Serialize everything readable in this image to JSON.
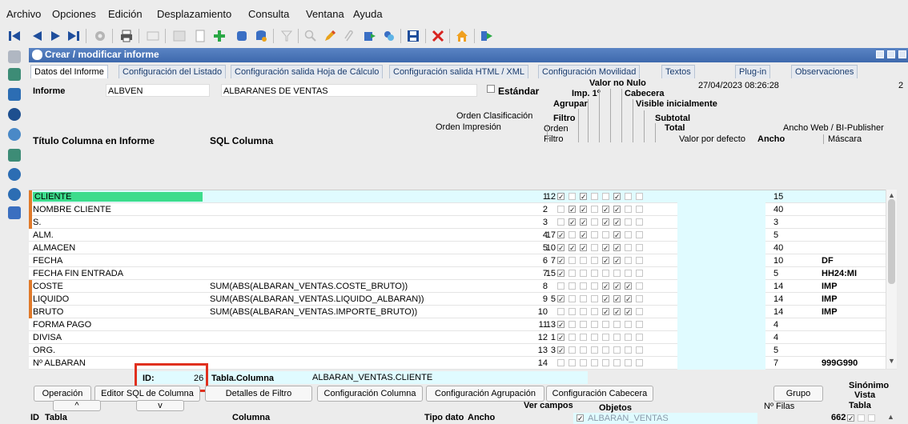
{
  "menu": [
    "Archivo",
    "Opciones",
    "Edición",
    "Desplazamiento",
    "Consulta",
    "Ventana",
    "Ayuda"
  ],
  "window_title": "Crear / modificar informe",
  "tabs": [
    "Datos del Informe",
    "Configuración del Listado",
    "Configuración salida Hoja de Cálculo",
    "Configuración salida HTML / XML",
    "Configuración Movilidad",
    "Textos",
    "Plug-in",
    "Observaciones"
  ],
  "header": {
    "informe_label": "Informe",
    "informe_code": "ALBVEN",
    "informe_name": "ALBARANES DE VENTAS",
    "estandar_label": "Estándar",
    "datetime": "27/04/2023 08:26:28",
    "count": "2"
  },
  "columns": {
    "titulo": "Título Columna en Informe",
    "sql": "SQL Columna",
    "orden_clasificacion": "Orden Clasificación",
    "orden_impresion": "Orden Impresión",
    "orden_filtro_1": "Orden",
    "orden_filtro_2": "Filtro",
    "valor_no_nulo": "Valor no Nulo",
    "imp1": "Imp. 1º",
    "cabecera": "Cabecera",
    "agrupar": "Agrupar",
    "visible": "Visible inicialmente",
    "filtro": "Filtro",
    "subtotal": "Subtotal",
    "total": "Total",
    "valor_defecto": "Valor por defecto",
    "ancho": "Ancho",
    "ancho_web": "Ancho Web / BI-Publisher",
    "mascara": "Máscara"
  },
  "rows": [
    {
      "titulo": "CLIENTE",
      "sql": "",
      "orden": "1",
      "filtro": "12",
      "checks": [
        1,
        0,
        1,
        0,
        0,
        1,
        0,
        0
      ],
      "ancho": "15",
      "mascara": "",
      "mark": "#e07a2a",
      "selected": true
    },
    {
      "titulo": "NOMBRE CLIENTE",
      "sql": "",
      "orden": "2",
      "filtro": "",
      "checks": [
        0,
        1,
        1,
        0,
        1,
        1,
        0,
        0
      ],
      "ancho": "40",
      "mascara": "",
      "mark": "#e07a2a"
    },
    {
      "titulo": "S.",
      "sql": "",
      "orden": "3",
      "filtro": "",
      "checks": [
        0,
        1,
        1,
        0,
        1,
        1,
        0,
        0
      ],
      "ancho": "3",
      "mascara": "",
      "mark": "#e07a2a"
    },
    {
      "titulo": "ALM.",
      "sql": "",
      "orden": "4",
      "filtro": "17",
      "checks": [
        1,
        0,
        1,
        0,
        0,
        1,
        0,
        0
      ],
      "ancho": "5",
      "mascara": "",
      "mark": ""
    },
    {
      "titulo": "ALMACEN",
      "sql": "",
      "orden": "5",
      "filtro": "10",
      "checks": [
        1,
        1,
        1,
        0,
        1,
        1,
        0,
        0
      ],
      "ancho": "40",
      "mascara": "",
      "mark": ""
    },
    {
      "titulo": "FECHA",
      "sql": "",
      "orden": "6",
      "filtro": "7",
      "checks": [
        1,
        0,
        0,
        0,
        1,
        1,
        0,
        0
      ],
      "ancho": "10",
      "mascara": "DF",
      "mark": ""
    },
    {
      "titulo": "FECHA FIN ENTRADA",
      "sql": "",
      "orden": "7",
      "filtro": "15",
      "checks": [
        1,
        0,
        0,
        0,
        0,
        0,
        0,
        0
      ],
      "ancho": "5",
      "mascara": "HH24:MI",
      "mark": ""
    },
    {
      "titulo": "COSTE",
      "sql": "SUM(ABS(ALBARAN_VENTAS.COSTE_BRUTO))",
      "orden": "8",
      "filtro": "",
      "checks": [
        0,
        0,
        0,
        0,
        1,
        1,
        1,
        0
      ],
      "ancho": "14",
      "mascara": "IMP",
      "mark": "#e07a2a"
    },
    {
      "titulo": "LIQUIDO",
      "sql": "SUM(ABS(ALBARAN_VENTAS.LIQUIDO_ALBARAN))",
      "orden": "9",
      "filtro": "5",
      "checks": [
        1,
        0,
        0,
        0,
        1,
        1,
        1,
        0
      ],
      "ancho": "14",
      "mascara": "IMP",
      "mark": "#e07a2a"
    },
    {
      "titulo": "BRUTO",
      "sql": "SUM(ABS(ALBARAN_VENTAS.IMPORTE_BRUTO))",
      "orden": "10",
      "filtro": "",
      "checks": [
        0,
        0,
        0,
        0,
        1,
        1,
        1,
        0
      ],
      "ancho": "14",
      "mascara": "IMP",
      "mark": "#e07a2a"
    },
    {
      "titulo": "FORMA PAGO",
      "sql": "",
      "orden": "11",
      "filtro": "13",
      "checks": [
        1,
        0,
        0,
        0,
        0,
        0,
        0,
        0
      ],
      "ancho": "4",
      "mascara": "",
      "mark": ""
    },
    {
      "titulo": "DIVISA",
      "sql": "",
      "orden": "12",
      "filtro": "1",
      "checks": [
        1,
        0,
        0,
        0,
        0,
        0,
        0,
        0
      ],
      "ancho": "4",
      "mascara": "",
      "mark": ""
    },
    {
      "titulo": "ORG.",
      "sql": "",
      "orden": "13",
      "filtro": "3",
      "checks": [
        1,
        0,
        0,
        0,
        0,
        0,
        0,
        0
      ],
      "ancho": "5",
      "mascara": "",
      "mark": ""
    },
    {
      "titulo": "Nº ALBARAN",
      "sql": "",
      "orden": "14",
      "filtro": "",
      "checks": [
        0,
        0,
        0,
        0,
        0,
        0,
        0,
        0
      ],
      "ancho": "7",
      "mascara": "999G990",
      "mark": ""
    }
  ],
  "footer": {
    "id_label": "ID:",
    "id_value": "26",
    "tabla_col_label": "Tabla.Columna",
    "tabla_col_value": "ALBARAN_VENTAS.CLIENTE",
    "buttons": [
      "Operación",
      "Editor SQL de Columna",
      "Detalles de Filtro",
      "Configuración Columna",
      "Configuración Agrupación",
      "Configuración Cabecera"
    ],
    "grupo": "Grupo",
    "sinonimo": "Sinónimo",
    "vista": "Vista",
    "tabla_right": "Tabla",
    "ver_campos": "Ver campos",
    "objetos": "Objetos",
    "objeto_val": "ALBARAN_VENTAS",
    "n_filas": "Nº Filas",
    "filas_value": "662",
    "up": "^",
    "down": "v",
    "bottom_headers": [
      "ID",
      "Tabla",
      "Columna",
      "Tipo dato",
      "Ancho"
    ]
  },
  "colors": {
    "highlight": "#e0fbff",
    "accent": "#3e69ad",
    "selected_cell": "#3cdc8c",
    "annotation": "#e0301e"
  }
}
